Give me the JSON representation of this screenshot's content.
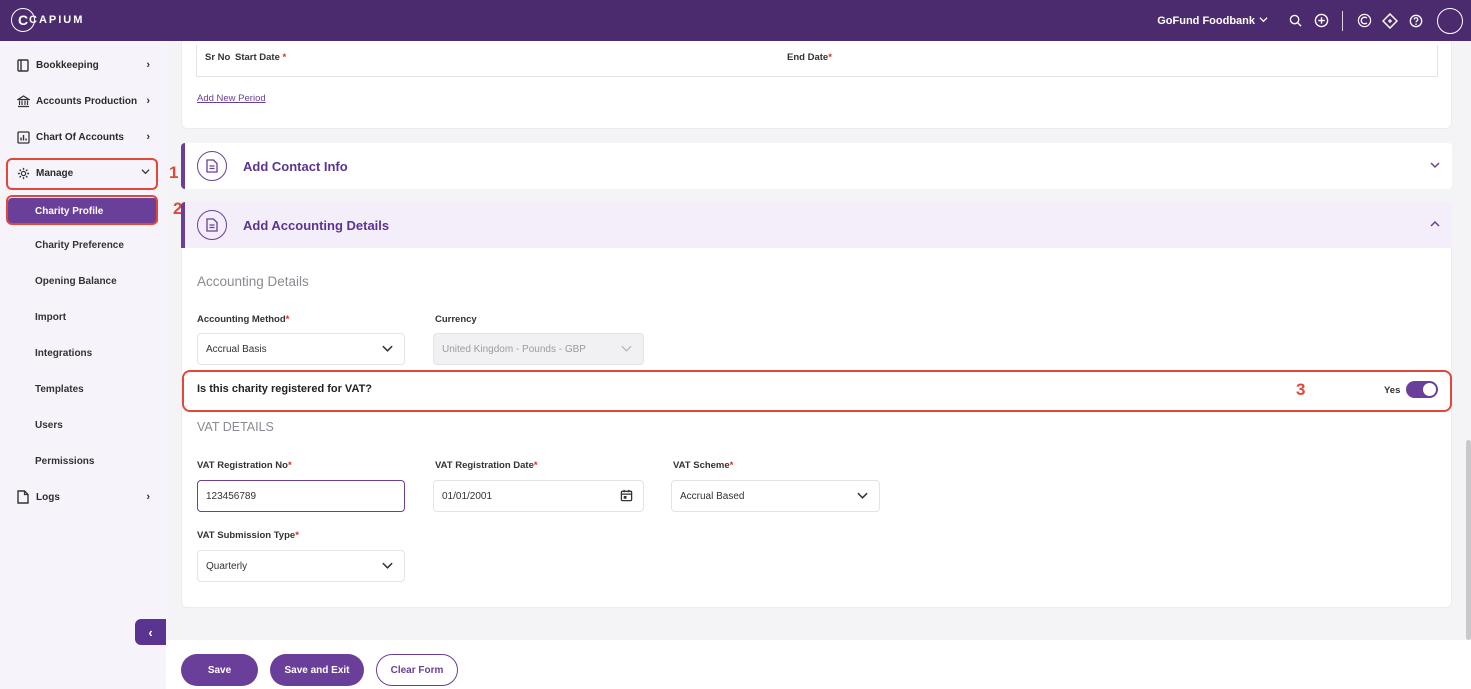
{
  "topbar": {
    "logo_text": "CAPIUM",
    "company": "GoFund Foodbank"
  },
  "sidebar": {
    "items": [
      {
        "label": "Bookkeeping"
      },
      {
        "label": "Accounts Production"
      },
      {
        "label": "Chart Of Accounts"
      },
      {
        "label": "Manage"
      },
      {
        "label": "Logs"
      }
    ],
    "manage_sub": [
      {
        "label": "Charity Profile"
      },
      {
        "label": "Charity Preference"
      },
      {
        "label": "Opening Balance"
      },
      {
        "label": "Import"
      },
      {
        "label": "Integrations"
      },
      {
        "label": "Templates"
      },
      {
        "label": "Users"
      },
      {
        "label": "Permissions"
      }
    ],
    "collapse_icon": "chevron-left-icon"
  },
  "annotations": {
    "step1": "1",
    "step2": "2",
    "step3": "3"
  },
  "periods": {
    "col_sr": "Sr No",
    "col_start": "Start Date",
    "col_end": "End Date",
    "required_mark": "*",
    "add_link": "Add New Period"
  },
  "accordions": {
    "contact": "Add Contact Info",
    "accounting": "Add Accounting Details"
  },
  "accounting_details": {
    "title": "Accounting Details",
    "method_label": "Accounting Method",
    "method_value": "Accrual Basis",
    "currency_label": "Currency",
    "currency_value": "United Kingdom - Pounds - GBP",
    "vat_question": "Is this charity registered for VAT?",
    "vat_toggle_label": "Yes",
    "vat_registered": true
  },
  "vat_details": {
    "title": "VAT DETAILS",
    "reg_no_label": "VAT Registration No",
    "reg_no_value": "123456789",
    "reg_date_label": "VAT Registration Date",
    "reg_date_value": "01/01/2001",
    "scheme_label": "VAT Scheme",
    "scheme_value": "Accrual Based",
    "submission_label": "VAT Submission Type",
    "submission_value": "Quarterly"
  },
  "footer": {
    "save": "Save",
    "save_exit": "Save and Exit",
    "clear": "Clear Form"
  },
  "colors": {
    "brand": "#4b2a6e",
    "accent": "#6a3f9a",
    "highlight": "#e0483a"
  }
}
